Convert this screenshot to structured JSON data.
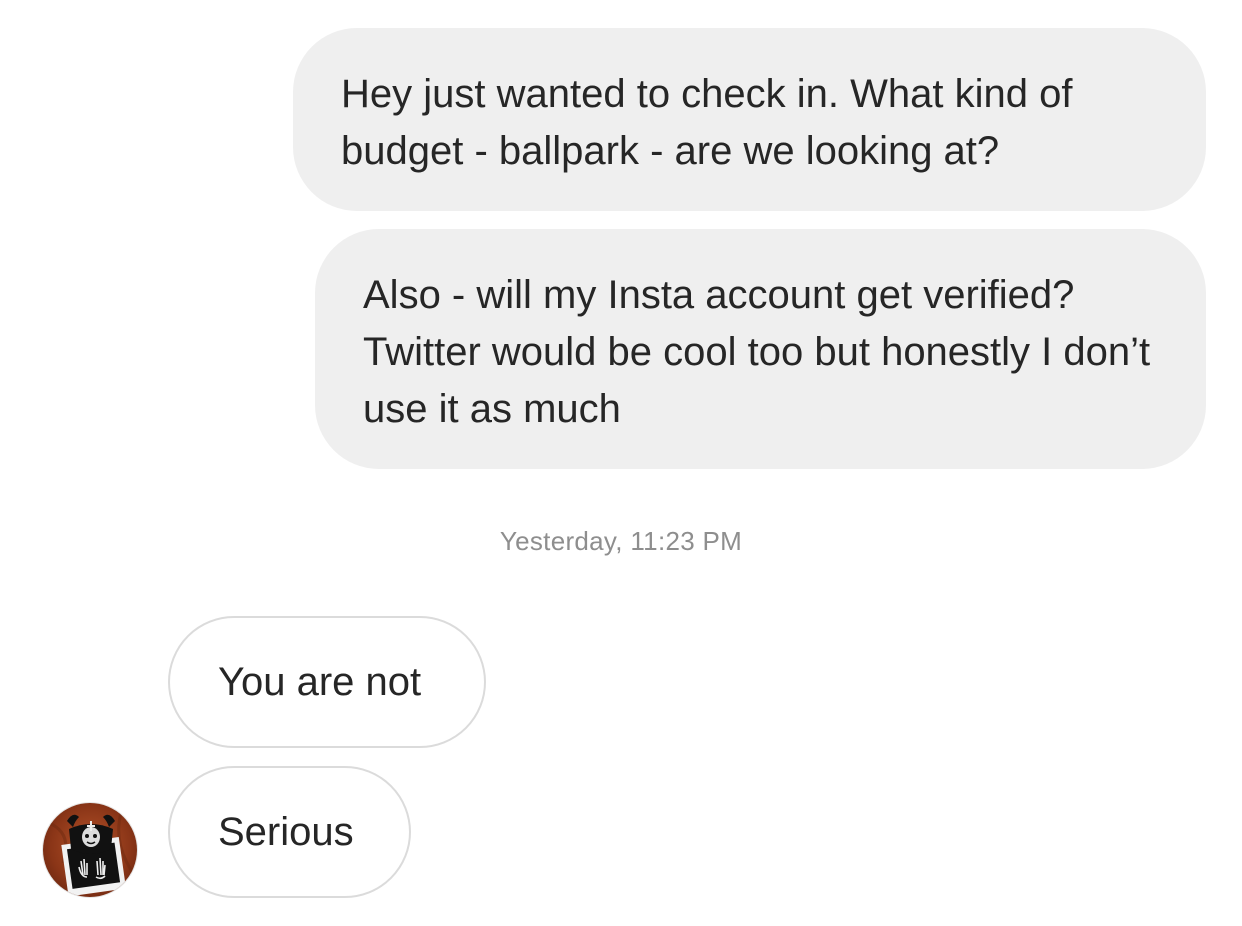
{
  "conversation": {
    "messages": [
      {
        "direction": "outgoing",
        "text": "Hey just wanted to check in. What kind of budget - ballpark - are we looking at?"
      },
      {
        "direction": "outgoing",
        "text": "Also - will my Insta account get verified? Twitter would be cool too but honestly I don’t use it as much"
      },
      {
        "direction": "incoming",
        "text": "You are not"
      },
      {
        "direction": "incoming",
        "text": "Serious"
      }
    ],
    "timestamp": "Yesterday, 11:23 PM",
    "sender_avatar_icon": "profile-avatar-icon"
  },
  "colors": {
    "outgoing_bubble": "#efefef",
    "incoming_border": "#dbdbdb",
    "text": "#262626",
    "timestamp": "#8e8e8e"
  }
}
